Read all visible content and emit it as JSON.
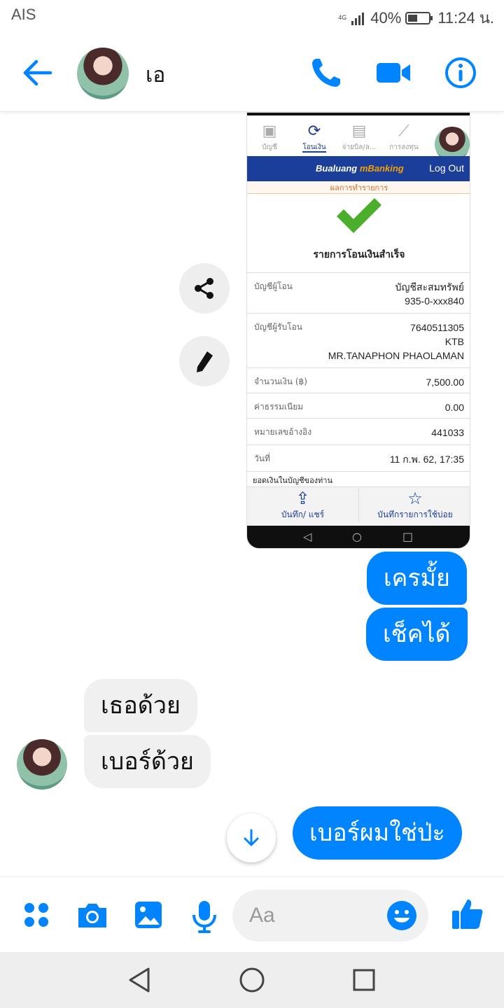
{
  "status_bar": {
    "carrier": "AIS",
    "network": "4G",
    "battery": "40%",
    "time": "11:24 น."
  },
  "header": {
    "contact_name": "เอ",
    "icons": [
      "back-arrow-icon",
      "phone-icon",
      "video-camera-icon",
      "info-icon"
    ]
  },
  "shared_image": {
    "tabs": [
      {
        "label": "บัญชี",
        "icon": "account-icon"
      },
      {
        "label": "โอนเงิน",
        "icon": "transfer-icon"
      },
      {
        "label": "จ่ายบิล/ล...",
        "icon": "bill-icon"
      },
      {
        "label": "การลงทุน",
        "icon": "chart-icon"
      }
    ],
    "brand": "Bualuang",
    "brand_suffix": "mBanking",
    "logout": "Log Out",
    "result_label": "ผลการทำรายการ",
    "success_title": "รายการโอนเงินสำเร็จ",
    "rows": [
      {
        "label": "บัญชีผู้โอน",
        "value": "บัญชีสะสมทรัพย์\n935-0-xxx840"
      },
      {
        "label": "บัญชีผู้รับโอน",
        "value": "7640511305\nKTB\nMR.TANAPHON PHAOLAMAN"
      },
      {
        "label": "จำนวนเงิน (฿)",
        "value": "7,500.00"
      },
      {
        "label": "ค่าธรรมเนียม",
        "value": "0.00"
      },
      {
        "label": "หมายเลขอ้างอิง",
        "value": "441033"
      },
      {
        "label": "วันที่",
        "value": "11 ก.พ. 62, 17:35"
      }
    ],
    "balance_label": "ยอดเงินในบัญชีของท่าน",
    "actions": [
      {
        "label": "บันทึก/ แชร์",
        "icon": "share-upload-icon"
      },
      {
        "label": "บันทึกรายการใช้บ่อย",
        "icon": "star-icon"
      }
    ]
  },
  "messages": [
    {
      "sender": "me",
      "text": "เครมั้ย"
    },
    {
      "sender": "me",
      "text": "เช็คได้"
    },
    {
      "sender": "them",
      "text": "เธอด้วย"
    },
    {
      "sender": "them",
      "text": "เบอร์ด้วย"
    },
    {
      "sender": "me",
      "text": "เบอร์ผมใช่ป่ะ"
    }
  ],
  "composer": {
    "placeholder": "Aa",
    "icons": [
      "apps-icon",
      "camera-icon",
      "gallery-icon",
      "microphone-icon",
      "emoji-icon",
      "thumbs-up-icon"
    ]
  },
  "colors": {
    "accent": "#0084ff",
    "incoming_bubble": "#f1f0f0",
    "bank_blue": "#1a3e9a",
    "check_green": "#4caf2b"
  }
}
